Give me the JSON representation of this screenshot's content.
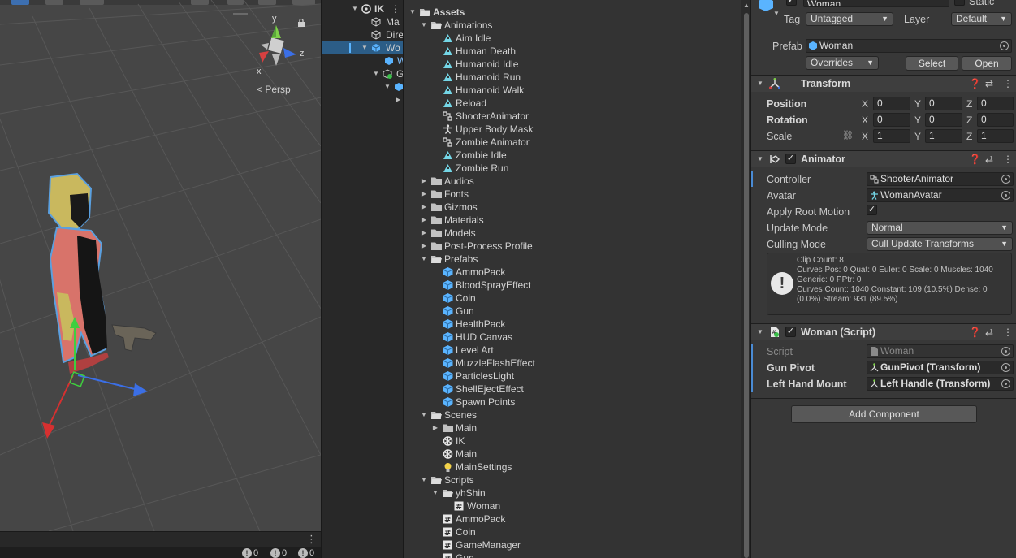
{
  "scene": {
    "gizmo": {
      "y_label": "y",
      "z_label": "z",
      "x_label": "x",
      "persp_label": "< Persp"
    },
    "console_counts": [
      {
        "icon": "info-icon",
        "count": "0"
      },
      {
        "icon": "warning-icon",
        "count": "0"
      },
      {
        "icon": "error-icon",
        "count": "0"
      }
    ]
  },
  "hierarchy": {
    "rows": [
      {
        "label": "IK",
        "icon": "unity-scene-icon"
      },
      {
        "label": "Ma",
        "icon": "gameobject-icon"
      },
      {
        "label": "Dire",
        "icon": "gameobject-icon"
      },
      {
        "label": "Wo",
        "icon": "prefab-icon"
      },
      {
        "label": "W",
        "icon": "prefab-icon"
      },
      {
        "label": "G",
        "icon": "gameobject-icon"
      }
    ]
  },
  "project": {
    "root": "Assets",
    "items": [
      {
        "label": "Animations",
        "icon": "folder-open-icon",
        "depth": 1,
        "fold": "open"
      },
      {
        "label": "Aim Idle",
        "icon": "animation-clip-icon",
        "depth": 2,
        "fold": ""
      },
      {
        "label": "Human Death",
        "icon": "animation-clip-icon",
        "depth": 2,
        "fold": ""
      },
      {
        "label": "Humanoid Idle",
        "icon": "animation-clip-icon",
        "depth": 2,
        "fold": ""
      },
      {
        "label": "Humanoid Run",
        "icon": "animation-clip-icon",
        "depth": 2,
        "fold": ""
      },
      {
        "label": "Humanoid Walk",
        "icon": "animation-clip-icon",
        "depth": 2,
        "fold": ""
      },
      {
        "label": "Reload",
        "icon": "animation-clip-icon",
        "depth": 2,
        "fold": ""
      },
      {
        "label": "ShooterAnimator",
        "icon": "animator-controller-icon",
        "depth": 2,
        "fold": ""
      },
      {
        "label": "Upper Body Mask",
        "icon": "avatar-mask-icon",
        "depth": 2,
        "fold": ""
      },
      {
        "label": "Zombie Animator",
        "icon": "animator-controller-icon",
        "depth": 2,
        "fold": ""
      },
      {
        "label": "Zombie Idle",
        "icon": "animation-clip-icon",
        "depth": 2,
        "fold": ""
      },
      {
        "label": "Zombie Run",
        "icon": "animation-clip-icon",
        "depth": 2,
        "fold": ""
      },
      {
        "label": "Audios",
        "icon": "folder-icon",
        "depth": 1,
        "fold": "closed"
      },
      {
        "label": "Fonts",
        "icon": "folder-icon",
        "depth": 1,
        "fold": "closed"
      },
      {
        "label": "Gizmos",
        "icon": "folder-icon",
        "depth": 1,
        "fold": "closed"
      },
      {
        "label": "Materials",
        "icon": "folder-icon",
        "depth": 1,
        "fold": "closed"
      },
      {
        "label": "Models",
        "icon": "folder-icon",
        "depth": 1,
        "fold": "closed"
      },
      {
        "label": "Post-Process Profile",
        "icon": "folder-icon",
        "depth": 1,
        "fold": "closed"
      },
      {
        "label": "Prefabs",
        "icon": "folder-open-icon",
        "depth": 1,
        "fold": "open"
      },
      {
        "label": "AmmoPack",
        "icon": "prefab-icon",
        "depth": 2,
        "fold": ""
      },
      {
        "label": "BloodSprayEffect",
        "icon": "prefab-icon",
        "depth": 2,
        "fold": ""
      },
      {
        "label": "Coin",
        "icon": "prefab-icon",
        "depth": 2,
        "fold": ""
      },
      {
        "label": "Gun",
        "icon": "prefab-icon",
        "depth": 2,
        "fold": ""
      },
      {
        "label": "HealthPack",
        "icon": "prefab-icon",
        "depth": 2,
        "fold": ""
      },
      {
        "label": "HUD Canvas",
        "icon": "prefab-icon",
        "depth": 2,
        "fold": ""
      },
      {
        "label": "Level Art",
        "icon": "prefab-icon",
        "depth": 2,
        "fold": ""
      },
      {
        "label": "MuzzleFlashEffect",
        "icon": "prefab-icon",
        "depth": 2,
        "fold": ""
      },
      {
        "label": "ParticlesLight",
        "icon": "prefab-icon",
        "depth": 2,
        "fold": ""
      },
      {
        "label": "ShellEjectEffect",
        "icon": "prefab-icon",
        "depth": 2,
        "fold": ""
      },
      {
        "label": "Spawn Points",
        "icon": "prefab-icon",
        "depth": 2,
        "fold": ""
      },
      {
        "label": "Scenes",
        "icon": "folder-open-icon",
        "depth": 1,
        "fold": "open"
      },
      {
        "label": "Main",
        "icon": "folder-icon",
        "depth": 2,
        "fold": "closed"
      },
      {
        "label": "IK",
        "icon": "unity-scene-icon",
        "depth": 2,
        "fold": ""
      },
      {
        "label": "Main",
        "icon": "unity-scene-icon",
        "depth": 2,
        "fold": ""
      },
      {
        "label": "MainSettings",
        "icon": "lighting-settings-icon",
        "depth": 2,
        "fold": ""
      },
      {
        "label": "Scripts",
        "icon": "folder-open-icon",
        "depth": 1,
        "fold": "open"
      },
      {
        "label": "yhShin",
        "icon": "folder-open-icon",
        "depth": 2,
        "fold": "open"
      },
      {
        "label": "Woman",
        "icon": "script-icon",
        "depth": 3,
        "fold": ""
      },
      {
        "label": "AmmoPack",
        "icon": "script-icon",
        "depth": 2,
        "fold": ""
      },
      {
        "label": "Coin",
        "icon": "script-icon",
        "depth": 2,
        "fold": ""
      },
      {
        "label": "GameManager",
        "icon": "script-icon",
        "depth": 2,
        "fold": ""
      },
      {
        "label": "Gun",
        "icon": "script-icon",
        "depth": 2,
        "fold": ""
      }
    ]
  },
  "inspector": {
    "object_name": "Woman",
    "static_label": "Static",
    "tag_label": "Tag",
    "tag_value": "Untagged",
    "layer_label": "Layer",
    "layer_value": "Default",
    "prefab_label": "Prefab",
    "prefab_value": "Woman",
    "overrides_label": "Overrides",
    "select_label": "Select",
    "open_label": "Open",
    "transform": {
      "title": "Transform",
      "position_label": "Position",
      "rotation_label": "Rotation",
      "scale_label": "Scale",
      "position": {
        "x": "0",
        "y": "0",
        "z": "0"
      },
      "rotation": {
        "x": "0",
        "y": "0",
        "z": "0"
      },
      "scale": {
        "x": "1",
        "y": "1",
        "z": "1"
      },
      "axis_x": "X",
      "axis_y": "Y",
      "axis_z": "Z"
    },
    "animator": {
      "title": "Animator",
      "enabled": true,
      "controller_label": "Controller",
      "controller_value": "ShooterAnimator",
      "avatar_label": "Avatar",
      "avatar_value": "WomanAvatar",
      "apply_root_motion_label": "Apply Root Motion",
      "apply_root_motion": true,
      "update_mode_label": "Update Mode",
      "update_mode_value": "Normal",
      "culling_mode_label": "Culling Mode",
      "culling_mode_value": "Cull Update Transforms",
      "info": "Clip Count: 8\nCurves Pos: 0 Quat: 0 Euler: 0 Scale: 0 Muscles: 1040\nGeneric: 0 PPtr: 0\nCurves Count: 1040 Constant: 109 (10.5%) Dense: 0 (0.0%) Stream: 931 (89.5%)"
    },
    "script_component": {
      "title": "Woman (Script)",
      "enabled": true,
      "script_label": "Script",
      "script_value": "Woman",
      "gun_pivot_label": "Gun Pivot",
      "gun_pivot_value": "GunPivot (Transform)",
      "left_hand_label": "Left Hand Mount",
      "left_hand_value": "Left Handle (Transform)"
    },
    "add_component_label": "Add Component"
  },
  "colors": {
    "selection": "#2c5d87",
    "prefab_blue": "#5ab4ff",
    "anim_teal": "#74d6e6",
    "scene_bg": "#464646"
  }
}
